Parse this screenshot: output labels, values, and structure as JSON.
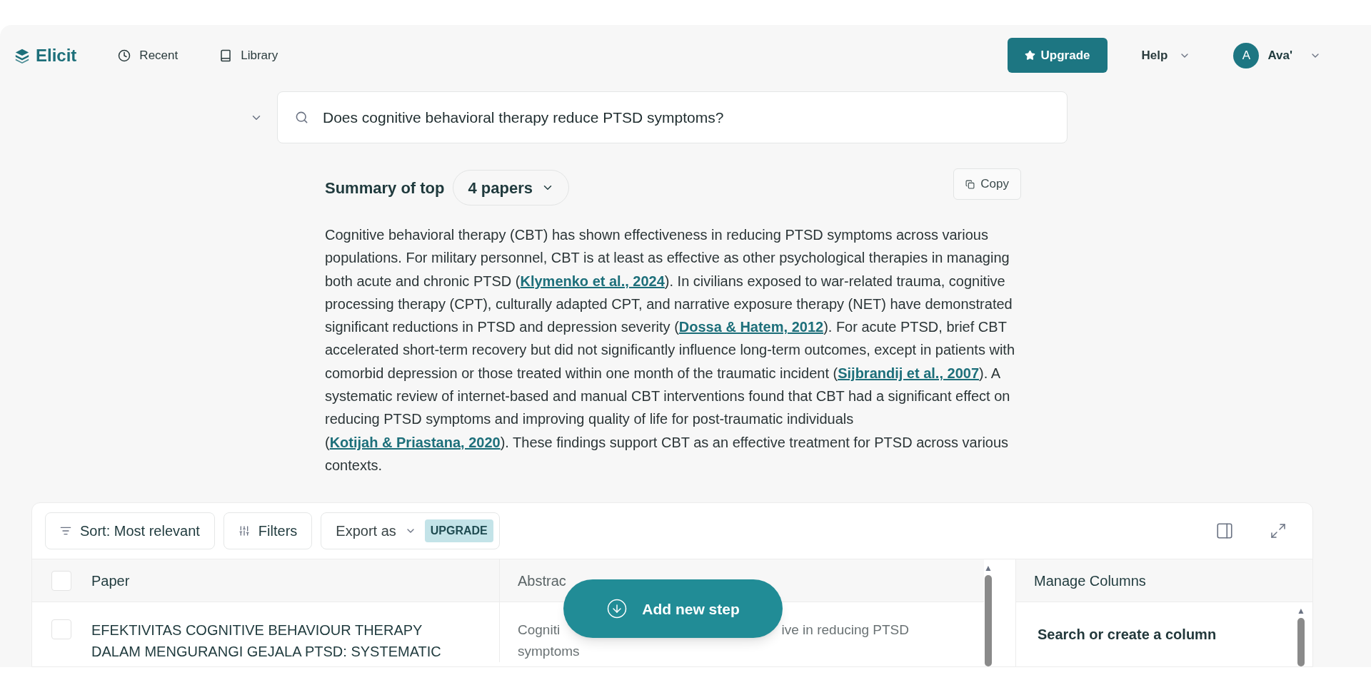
{
  "nav": {
    "logo": "Elicit",
    "links": [
      {
        "kind": "recent",
        "label": "Recent"
      },
      {
        "kind": "library",
        "label": "Library"
      }
    ],
    "upgrade": "Upgrade",
    "help": "Help",
    "user": {
      "initial": "A",
      "name": "Ava'"
    }
  },
  "search": {
    "value": "Does cognitive behavioral therapy reduce PTSD symptoms?"
  },
  "summary": {
    "title": "Summary of top",
    "papers": "4 papers",
    "copy": "Copy",
    "text": [
      {
        "kind": "text",
        "t": "Cognitive behavioral therapy (CBT) has shown effectiveness in reducing PTSD symptoms across various populations. For military personnel, CBT is at least as effective as other psychological therapies in managing both acute and chronic PTSD ("
      },
      {
        "kind": "cite",
        "t": "Klymenko et al., 2024"
      },
      {
        "kind": "text",
        "t": "). In civilians exposed to war-related trauma, cognitive processing therapy (CPT), culturally adapted CPT, and narrative exposure therapy (NET) have demonstrated significant reductions in PTSD and depression severity ("
      },
      {
        "kind": "cite",
        "t": "Dossa & Hatem, 2012"
      },
      {
        "kind": "text",
        "t": "). For acute PTSD, brief CBT accelerated short-term recovery but did not significantly influence long-term outcomes, except in patients with comorbid depression or those treated within one month of the traumatic incident ("
      },
      {
        "kind": "cite",
        "t": "Sijbrandij et al., 2007"
      },
      {
        "kind": "text",
        "t": "). A systematic review of internet-based and manual CBT interventions found that CBT had a significant effect on reducing PTSD symptoms and improving quality of life for post-traumatic individuals ("
      },
      {
        "kind": "cite",
        "t": "Kotijah & Priastana, 2020"
      },
      {
        "kind": "text",
        "t": "). These findings support CBT as an effective treatment for PTSD across various contexts."
      }
    ]
  },
  "table": {
    "sort": "Sort: Most relevant",
    "filters": "Filters",
    "export": "Export as",
    "export_badge": "UPGRADE",
    "select_all": {
      "checked": false
    },
    "scroll_up": "▲",
    "columns": [
      "Paper",
      "Abstrac"
    ],
    "rows": [
      {
        "checked": false,
        "paper": "EFEKTIVITAS COGNITIVE BEHAVIOUR THERAPY DALAM MENGURANGI GEJALA PTSD: SYSTEMATIC",
        "abstract": [
          "Cogniti",
          "ive in reducing PTSD",
          "symptoms"
        ]
      }
    ],
    "panel": {
      "title": "Manage Columns",
      "search": "Search or create a column"
    }
  },
  "add_step": "Add new step"
}
